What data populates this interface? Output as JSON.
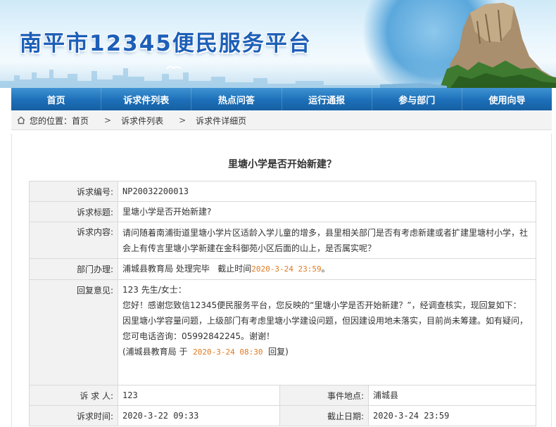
{
  "header": {
    "site_title": "南平市12345便民服务平台"
  },
  "nav": {
    "items": [
      {
        "label": "首页"
      },
      {
        "label": "诉求件列表"
      },
      {
        "label": "热点问答"
      },
      {
        "label": "运行通报"
      },
      {
        "label": "参与部门"
      },
      {
        "label": "使用向导"
      }
    ]
  },
  "breadcrumb": {
    "prefix": "您的位置：",
    "home": "首页",
    "sep": ">",
    "list": "诉求件列表",
    "current": "诉求件详细页"
  },
  "page": {
    "title": "里塘小学是否开始新建？"
  },
  "detail": {
    "number_label": "诉求编号:",
    "number_value": "NP20032200013",
    "subject_label": "诉求标题:",
    "subject_value": "里塘小学是否开始新建?",
    "content_label": "诉求内容:",
    "content_line1": "请问随着南浦街道里塘小学片区适龄入学儿童的增多，县里相关部门是否有考虑新建或者扩建里塘村小学，社",
    "content_line2": "会上有传言里塘小学新建在金科御苑小区后面的山上，是否属实呢？",
    "dept_label": "部门办理:",
    "dept_value": "浦城县教育局 处理完毕",
    "deadline_prefix": "截止时间",
    "deadline_value": "2020-3-24 23:59",
    "deadline_suffix": "。",
    "reply_label": "回复意见:",
    "reply_greeting": "123 先生/女士：",
    "reply_line1": "您好！感谢您致信12345便民服务平台，您反映的“里塘小学是否开始新建？”，经调查核实，现回复如下：",
    "reply_line2": "因里塘小学容量问题，上级部门有考虑里塘小学建设问题，但因建设用地未落实，目前尚未筹建。如有疑问，",
    "reply_line3": "您可电话咨询：05992842245。谢谢！",
    "reply_sign_prefix": "(浦城县教育局 于",
    "reply_sign_time": "2020-3-24 08:30",
    "reply_sign_suffix": "回复)",
    "petitioner_label": "诉 求 人:",
    "petitioner_value": "123",
    "location_label": "事件地点:",
    "location_value": "浦城县",
    "time_label": "诉求时间:",
    "time_value": "2020-3-22 09:33",
    "due_label": "截止日期:",
    "due_value": "2020-3-24 23:59"
  },
  "colors": {
    "nav_blue": "#1c6fb8",
    "title_blue": "#1d5fb8",
    "highlight_orange": "#e07a1f"
  }
}
